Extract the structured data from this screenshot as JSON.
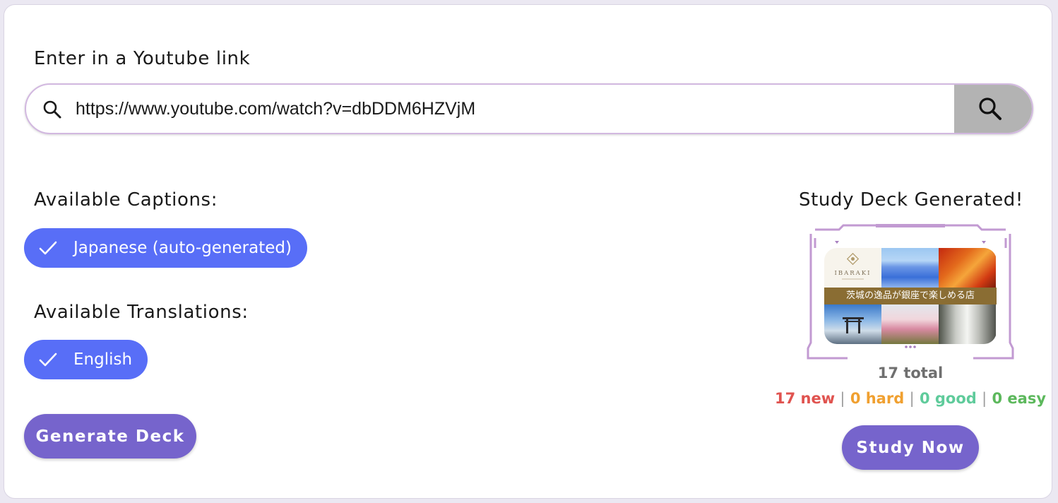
{
  "url_section": {
    "heading": "Enter in a Youtube link",
    "input_value": "https://www.youtube.com/watch?v=dbDDM6HZVjM"
  },
  "captions": {
    "heading": "Available Captions:",
    "selected": "Japanese (auto-generated)"
  },
  "translations": {
    "heading": "Available Translations:",
    "selected": "English"
  },
  "generate_button": "Generate Deck",
  "deck": {
    "heading": "Study Deck Generated!",
    "logo_text": "IBARAKI",
    "banner_text": "茨城の逸品が銀座で楽しめる店",
    "total": "17 total",
    "new": "17 new",
    "hard": "0 hard",
    "good": "0 good",
    "easy": "0 easy",
    "separator": "|",
    "study_button": "Study Now"
  },
  "colors": {
    "chip": "#586ef7",
    "button": "#7664cc",
    "new": "#e0534f",
    "hard": "#f0a030",
    "good": "#5fcb9b",
    "easy": "#5cb85c",
    "frame": "#c29ad2"
  },
  "icons": {
    "search_lead": "search-icon",
    "search_button": "search-icon",
    "chip_check": "check-icon"
  }
}
